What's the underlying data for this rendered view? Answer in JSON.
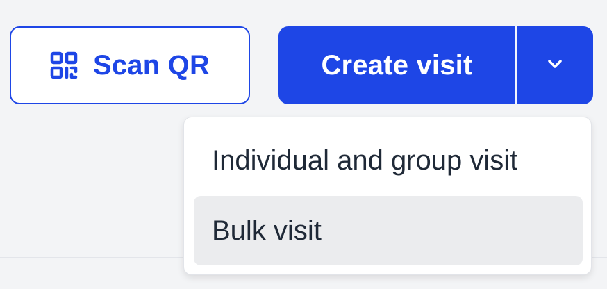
{
  "scan_button": {
    "label": "Scan QR",
    "icon": "qr-code-icon"
  },
  "create_button": {
    "label": "Create visit",
    "toggle_icon": "chevron-down-icon"
  },
  "dropdown": {
    "items": [
      {
        "label": "Individual and group visit",
        "highlighted": false
      },
      {
        "label": "Bulk visit",
        "highlighted": true
      }
    ]
  },
  "colors": {
    "primary": "#1e46e6",
    "background": "#f3f4f6",
    "menu_hover": "#ebecee",
    "text": "#1f2937"
  }
}
